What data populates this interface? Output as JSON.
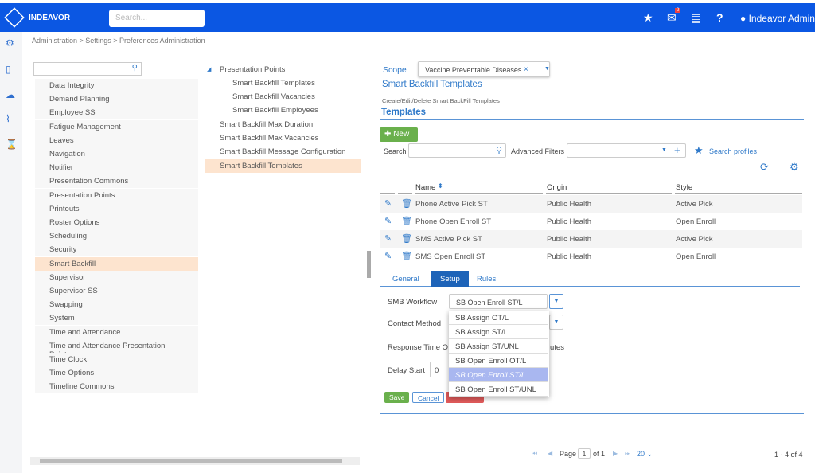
{
  "app": {
    "brand": "INDEAVOR",
    "search_placeholder": "Search...",
    "user": "Indeavor Admin",
    "mail_badge": "2"
  },
  "breadcrumb": "Administration > Settings > Preferences Administration",
  "left_list": [
    "Data Integrity",
    "Demand Planning",
    "Employee SS",
    "Fatigue Management",
    "Leaves",
    "Navigation",
    "Notifier",
    "Presentation Commons",
    "Presentation Points",
    "Printouts",
    "Roster Options",
    "Scheduling",
    "Security",
    "Smart Backfill",
    "Supervisor",
    "Supervisor SS",
    "Swapping",
    "System",
    "Time and Attendance",
    "Time and Attendance Presentation Points",
    "Time Clock",
    "Time Options",
    "Timeline Commons"
  ],
  "left_selected": "Smart Backfill",
  "tree": {
    "parent": "Presentation Points",
    "children": [
      "Smart Backfill Templates",
      "Smart Backfill Vacancies",
      "Smart Backfill Employees"
    ],
    "items": [
      "Smart Backfill Max Duration",
      "Smart Backfill Max Vacancies",
      "Smart Backfill Message Configuration",
      "Smart Backfill Templates"
    ]
  },
  "main": {
    "scope_label": "Scope",
    "scope_value": "Vaccine Preventable Diseases",
    "title": "Smart Backfill Templates",
    "description": "Create/Edit/Delete Smart BackFill Templates",
    "section": "Templates",
    "new_label": "New",
    "search_label": "Search",
    "adv_filters_label": "Advanced Filters",
    "search_profiles": "Search profiles",
    "columns": [
      "Name",
      "Origin",
      "Style"
    ],
    "rows": [
      [
        "Phone Active Pick ST",
        "Public Health",
        "Active Pick"
      ],
      [
        "Phone Open Enroll ST",
        "Public Health",
        "Open Enroll"
      ],
      [
        "SMS Active Pick ST",
        "Public Health",
        "Active Pick"
      ],
      [
        "SMS Open Enroll ST",
        "Public Health",
        "Open Enroll"
      ]
    ],
    "tabs": [
      "General",
      "Setup",
      "Rules"
    ],
    "active_tab": "Setup",
    "smb_label": "SMB Workflow",
    "smb_value": "SB Open Enroll ST/L",
    "contact_label": "Contact Method",
    "response_label": "Response Time O",
    "response_suffix": "utes",
    "delay_label": "Delay Start",
    "delay_value": "0",
    "save": "Save",
    "cancel": "Cancel",
    "dropdown_options": [
      "SB Assign OT/L",
      "SB Assign ST/L",
      "SB Assign ST/UNL",
      "SB Open Enroll OT/L",
      "SB Open Enroll ST/L",
      "SB Open Enroll ST/UNL"
    ],
    "dropdown_highlight": "SB Open Enroll ST/L",
    "pager": {
      "page_label": "Page",
      "page": "1",
      "of": "of 1",
      "page_size": "20",
      "summary": "1 - 4 of 4"
    }
  },
  "colors": {
    "topbar": "#0b57e3",
    "accent": "#2f79c9",
    "selected": "#fde4cf",
    "new_button": "#6ab04c"
  }
}
